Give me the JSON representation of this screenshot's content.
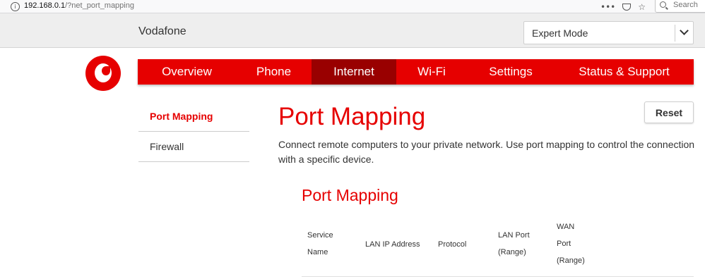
{
  "browser": {
    "url_host": "192.168.0.1",
    "url_path": "/?net_port_mapping",
    "overflow_glyph": "•••",
    "bookmark_glyph": "☆",
    "search_placeholder": "Search"
  },
  "header": {
    "brand": "Vodafone",
    "mode_select_value": "Expert Mode"
  },
  "nav": {
    "items": [
      {
        "label": "Overview"
      },
      {
        "label": "Phone"
      },
      {
        "label": "Internet"
      },
      {
        "label": "Wi-Fi"
      },
      {
        "label": "Settings"
      },
      {
        "label": "Status & Support"
      }
    ]
  },
  "sidebar": {
    "items": [
      {
        "label": "Port Mapping"
      },
      {
        "label": "Firewall"
      }
    ]
  },
  "main": {
    "title": "Port Mapping",
    "reset_label": "Reset",
    "description": "Connect remote computers to your private network. Use port mapping to control the connection with a specific device.",
    "section_title": "Port Mapping",
    "table_headers": {
      "service": [
        "Service",
        "Name"
      ],
      "lan_ip": "LAN IP Address",
      "protocol": "Protocol",
      "lan_port": [
        "LAN Port",
        "(Range)"
      ],
      "wan_port": [
        "WAN",
        "Port",
        "(Range)"
      ]
    }
  },
  "colors": {
    "brand_red": "#e60000",
    "active_tab": "#990000"
  }
}
